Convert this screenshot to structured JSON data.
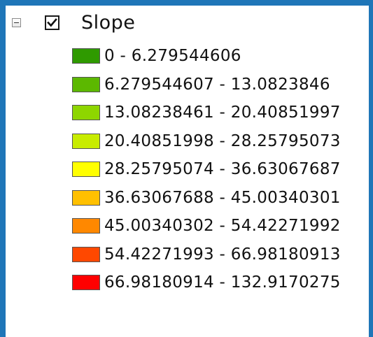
{
  "layer": {
    "name": "Slope",
    "checked": true,
    "expanded": true
  },
  "legend": {
    "classes": [
      {
        "label": "0 - 6.279544606",
        "color": "#2f9a00"
      },
      {
        "label": "6.279544607 - 13.0823846",
        "color": "#5cb800"
      },
      {
        "label": "13.08238461 - 20.40851997",
        "color": "#8ed600"
      },
      {
        "label": "20.40851998 - 28.25795073",
        "color": "#c8ec00"
      },
      {
        "label": "28.25795074 - 36.63067687",
        "color": "#ffff00"
      },
      {
        "label": "36.63067688 - 45.00340301",
        "color": "#ffc000"
      },
      {
        "label": "45.00340302 - 54.42271992",
        "color": "#ff8800"
      },
      {
        "label": "54.42271993 - 66.98180913",
        "color": "#ff4800"
      },
      {
        "label": "66.98180914 - 132.9170275",
        "color": "#ff0000"
      }
    ]
  },
  "icons": {
    "expander": "collapse-minus-icon",
    "checkbox": "checkmark-icon"
  },
  "theme": {
    "frame_color": "#1f76b8"
  }
}
